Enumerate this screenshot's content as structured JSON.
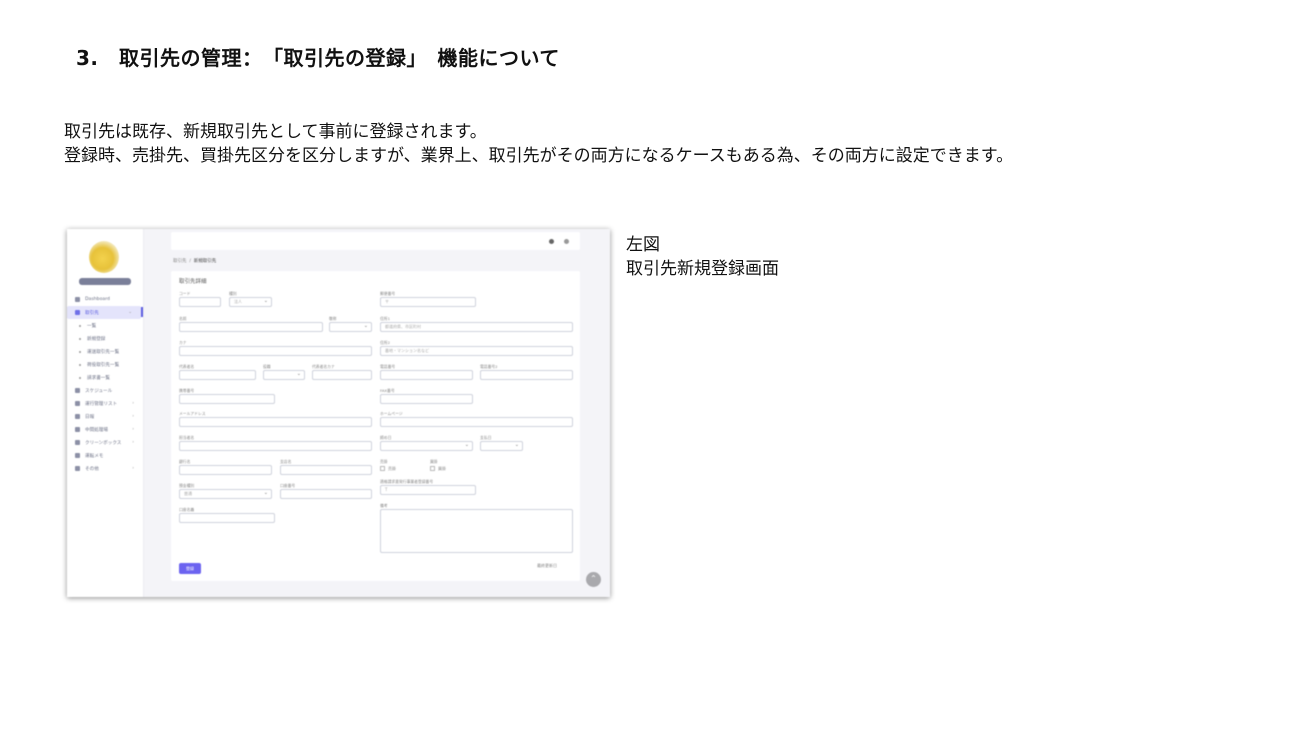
{
  "slide": {
    "title": "3.　取引先の管理：　「取引先の登録」　機能について",
    "intro_lines": [
      "取引先は既存、新規取引先として事前に登録されます。",
      "登録時、売掛先、買掛先区分を区分しますが、業界上、取引先がその両方になるケースもある為、その両方に設定できます。"
    ],
    "caption_lines": [
      "左図",
      "取引先新規登録画面"
    ]
  },
  "screenshot": {
    "sidebar": {
      "items": [
        {
          "label": "Dashboard"
        },
        {
          "label": "取引先",
          "active": true
        },
        {
          "label": "一覧",
          "sub": true
        },
        {
          "label": "新規登録",
          "sub": true
        },
        {
          "label": "運送取引先一覧",
          "sub": true
        },
        {
          "label": "荷役取引先一覧",
          "sub": true
        },
        {
          "label": "請求書一覧",
          "sub": true
        },
        {
          "label": "スケジュール"
        },
        {
          "label": "運行管理リスト"
        },
        {
          "label": "日報"
        },
        {
          "label": "中間処理場"
        },
        {
          "label": "クリーンボックス"
        },
        {
          "label": "運転メモ"
        },
        {
          "label": "その他"
        }
      ]
    },
    "breadcrumb": {
      "root": "取引先",
      "separator": "/",
      "current": "新規取引先"
    },
    "form": {
      "title": "取引先詳細",
      "fields": {
        "code": "コード",
        "type": "種別",
        "type_value": "法人",
        "postal": "郵便番号",
        "postal_placeholder": "〒",
        "name": "名前",
        "honorific": "敬称",
        "address1": "住所1",
        "address1_placeholder": "都道府県、市区町村",
        "kana": "カナ",
        "address2": "住所2",
        "address2_placeholder": "番地・マンション名など",
        "rep_name": "代表者名",
        "rep_title": "役職",
        "rep_kana": "代表者名カナ",
        "phone": "電話番号",
        "phone2": "電話番号2",
        "mobile": "携帯番号",
        "fax": "FAX番号",
        "email": "メールアドレス",
        "homepage": "ホームページ",
        "contact": "担当者名",
        "closing": "締め日",
        "payday": "支払日",
        "bank": "銀行名",
        "branch": "支店名",
        "deposit_type": "預金種別",
        "deposit_value": "普通",
        "account_no": "口座番号",
        "account_holder": "口座名義",
        "receivable_label": "売掛",
        "receivable_option": "売掛",
        "payable_label": "買掛",
        "payable_option": "買掛",
        "invoice_no": "適格請求書発行事業者登録番号",
        "invoice_prefix": "T",
        "memo": "備考"
      },
      "submit": "登録",
      "footer_link": "最終更新日"
    }
  }
}
